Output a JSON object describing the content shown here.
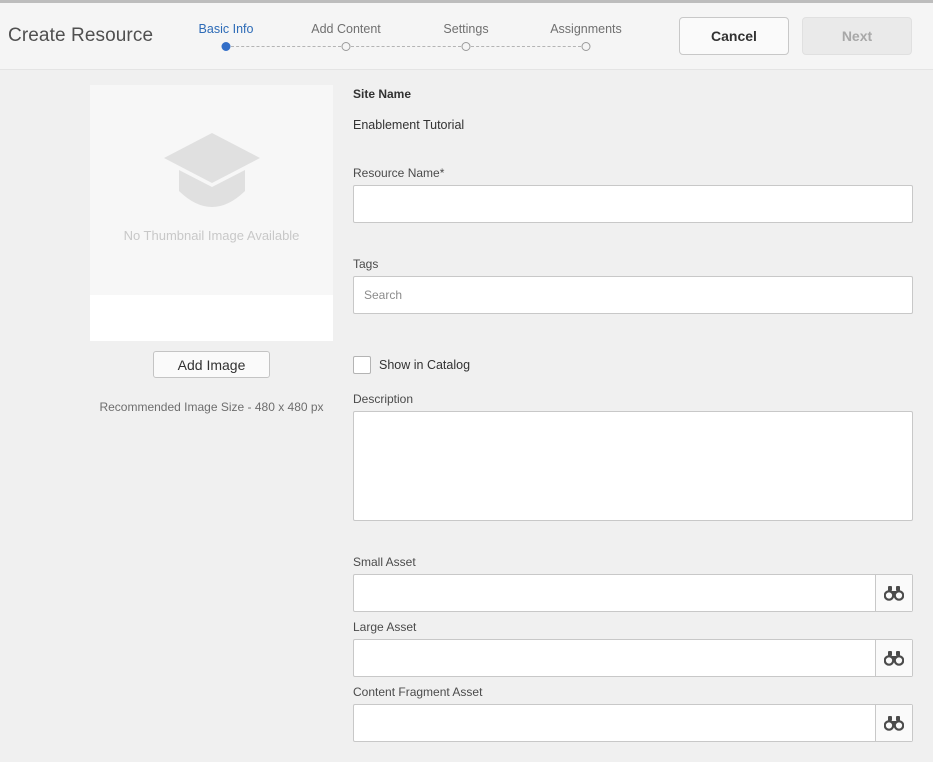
{
  "header": {
    "title": "Create Resource",
    "steps": [
      {
        "label": "Basic Info",
        "active": true
      },
      {
        "label": "Add Content",
        "active": false
      },
      {
        "label": "Settings",
        "active": false
      },
      {
        "label": "Assignments",
        "active": false
      }
    ],
    "cancel_label": "Cancel",
    "next_label": "Next"
  },
  "thumbnail": {
    "placeholder_text": "No Thumbnail Image Available",
    "icon": "graduation-cap-icon",
    "add_image_label": "Add Image",
    "recommended_size": "Recommended Image Size - 480 x 480 px"
  },
  "form": {
    "site_name_label": "Site Name",
    "site_name_value": "Enablement Tutorial",
    "resource_name_label": "Resource Name*",
    "resource_name_value": "",
    "tags_label": "Tags",
    "tags_placeholder": "Search",
    "show_in_catalog_label": "Show in Catalog",
    "show_in_catalog_checked": false,
    "description_label": "Description",
    "description_value": "",
    "small_asset_label": "Small Asset",
    "large_asset_label": "Large Asset",
    "content_fragment_label": "Content Fragment Asset",
    "browse_icon": "binoculars-icon"
  },
  "colors": {
    "accent": "#326ec8",
    "background": "#f0f0f0"
  }
}
